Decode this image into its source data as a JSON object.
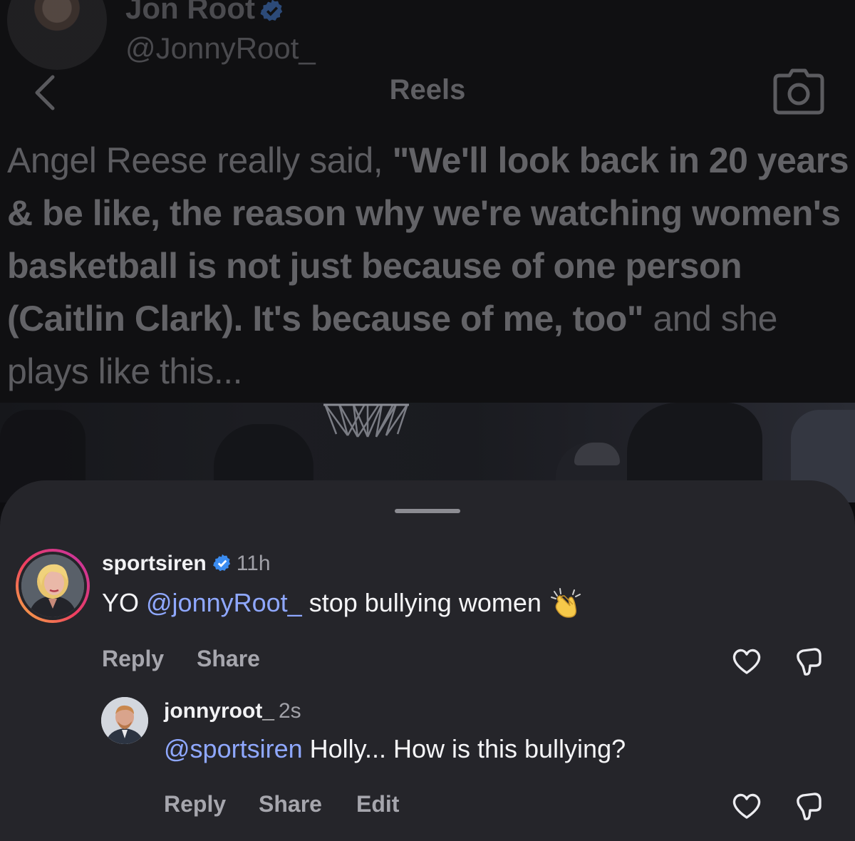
{
  "post": {
    "author_name": "Jon Root",
    "author_handle": "@JonnyRoot_",
    "header_title": "Reels",
    "caption_lead": "Angel Reese really said, ",
    "caption_quote": "\"We'll look back in 20 years & be like, the reason why we're watching women's basketball is not just because of one person (Caitlin Clark). It's because of me, too\"",
    "caption_tail": " and she plays like this..."
  },
  "comments": [
    {
      "username": "sportsiren",
      "time": "11h",
      "text_prefix": "YO ",
      "mention": "@jonnyRoot_",
      "text_suffix": " stop bullying women",
      "emoji": "clapping-hands",
      "actions": {
        "reply": "Reply",
        "share": "Share"
      }
    },
    {
      "username": "jonnyroot_",
      "time": "2s",
      "mention": "@sportsiren",
      "text_suffix": " Holly... How is this bullying?",
      "actions": {
        "reply": "Reply",
        "share": "Share",
        "edit": "Edit"
      }
    }
  ],
  "icons": {
    "back": "chevron-left-icon",
    "camera": "camera-icon",
    "like": "heart-icon",
    "dislike": "dislike-icon",
    "verified": "verified-badge-icon"
  },
  "colors": {
    "sheet_background": "#25252a",
    "mention": "#8fa8ff",
    "verified": "#3b8cf0"
  }
}
